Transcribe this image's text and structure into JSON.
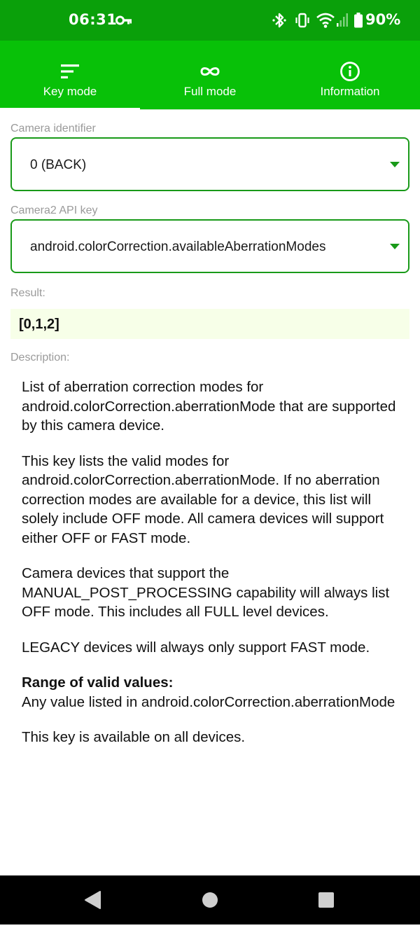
{
  "status_bar": {
    "time": "06:31",
    "battery": "90%",
    "icons": [
      "vpn-key-icon",
      "bluetooth-icon",
      "vibrate-icon",
      "wifi-icon",
      "cellular-signal-icon",
      "battery-icon"
    ]
  },
  "tabs": [
    {
      "label": "Key mode",
      "icon": "sort-lines-icon",
      "active": true
    },
    {
      "label": "Full mode",
      "icon": "infinity-icon",
      "active": false
    },
    {
      "label": "Information",
      "icon": "info-icon",
      "active": false
    }
  ],
  "camera_identifier": {
    "label": "Camera identifier",
    "value": "0 (BACK)"
  },
  "api_key": {
    "label": "Camera2 API key",
    "value": "android.colorCorrection.availableAberrationModes"
  },
  "result": {
    "label": "Result:",
    "value": "[0,1,2]"
  },
  "description": {
    "label": "Description:",
    "paragraphs": [
      "List of aberration correction modes for android.colorCorrection.aberrationMode that are supported by this camera device.",
      "This key lists the valid modes for android.colorCorrection.aberrationMode. If no aberration correction modes are available for a device, this list will solely include OFF mode. All camera devices will support either OFF or FAST mode.",
      "Camera devices that support the MANUAL_POST_PROCESSING capability will always list OFF mode. This includes all FULL level devices.",
      "LEGACY devices will always only support FAST mode."
    ],
    "range_title": "Range of valid values:",
    "range_body": "Any value listed in android.colorCorrection.aberrationMode",
    "availability": "This key is available on all devices."
  },
  "nav_bar": {
    "buttons": [
      "back-icon",
      "home-icon",
      "recents-icon"
    ]
  },
  "colors": {
    "status_bar": "#0aa00a",
    "tab_bar": "#08c108",
    "accent": "#199a19",
    "result_bg": "#f7ffe8"
  }
}
